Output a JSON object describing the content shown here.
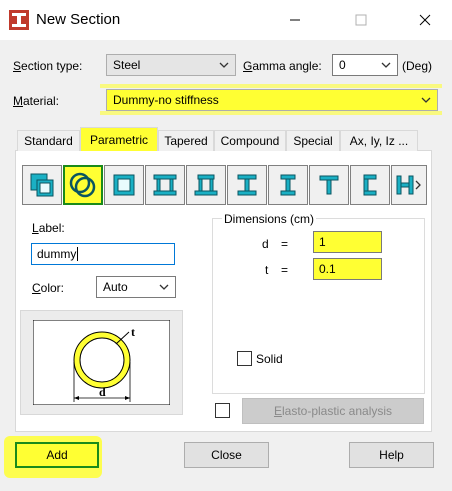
{
  "window": {
    "title": "New Section",
    "icon": "i-beam-section-icon"
  },
  "section_type": {
    "label": "Section type:",
    "value": "Steel"
  },
  "gamma_angle": {
    "label": "Gamma angle:",
    "value": "0",
    "unit": "(Deg)"
  },
  "material": {
    "label": "Material:",
    "value": "Dummy-no stiffness"
  },
  "tabs": [
    {
      "label": "Standard"
    },
    {
      "label": "Parametric",
      "selected": true
    },
    {
      "label": "Tapered"
    },
    {
      "label": "Compound"
    },
    {
      "label": "Special"
    },
    {
      "label": "Ax, Iy, Iz ..."
    }
  ],
  "shapes": [
    {
      "icon": "box-hollow-square-icon"
    },
    {
      "icon": "circular-tube-icon",
      "selected": true
    },
    {
      "icon": "rectangular-tube-icon"
    },
    {
      "icon": "box-double-web-icon"
    },
    {
      "icon": "box-flanged-icon"
    },
    {
      "icon": "i-section-icon"
    },
    {
      "icon": "i-section-tall-icon"
    },
    {
      "icon": "t-section-icon"
    },
    {
      "icon": "channel-section-icon"
    },
    {
      "icon": "more-shapes-icon"
    }
  ],
  "label_field": {
    "label": "Label:",
    "value": "dummy"
  },
  "color": {
    "label": "Color:",
    "value": "Auto"
  },
  "dimensions": {
    "title": "Dimensions (cm)",
    "rows": [
      {
        "name": "d",
        "eq": "=",
        "value": "1"
      },
      {
        "name": "t",
        "eq": "=",
        "value": "0.1"
      }
    ]
  },
  "diagram": {
    "t_label": "t",
    "d_label": "d"
  },
  "solid": {
    "label": "Solid",
    "checked": false
  },
  "elasto": {
    "label": "Elasto-plastic analysis",
    "checked": false
  },
  "buttons": {
    "add": "Add",
    "close": "Close",
    "help": "Help"
  },
  "colors": {
    "highlight": "#ffff33",
    "tube": "#ffff33",
    "selection_border": "#1a8a1a"
  }
}
